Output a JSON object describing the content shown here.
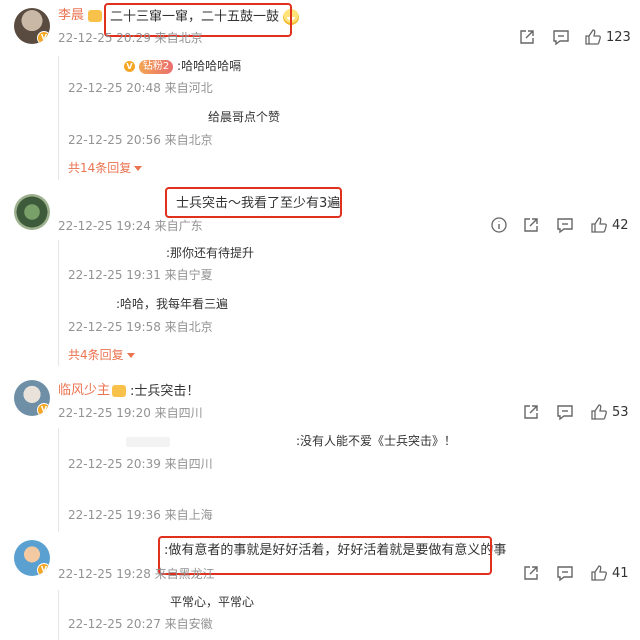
{
  "comments": [
    {
      "username": "李晨",
      "text": "二十三窜一窜，二十五鼓一鼓",
      "meta": "22-12-25 20:29 来自北京",
      "likes": "123",
      "replies": [
        {
          "text": ":哈哈哈哈嗝",
          "badge": "钻粉2",
          "meta": "22-12-25 20:48 来自河北"
        },
        {
          "text": "给晨哥点个赞",
          "meta": "22-12-25 20:56 来自北京"
        }
      ],
      "more": "共14条回复"
    },
    {
      "username": "",
      "text": "士兵突击～我看了至少有3遍",
      "meta": "22-12-25 19:24 来自广东",
      "likes": "42",
      "replies": [
        {
          "text": ":那你还有待提升",
          "meta": "22-12-25 19:31 来自宁夏"
        },
        {
          "text": ":哈哈，我每年看三遍",
          "meta": "22-12-25 19:58 来自北京"
        }
      ],
      "more": "共4条回复"
    },
    {
      "username": "临风少主",
      "text": ":士兵突击！",
      "meta": "22-12-25 19:20 来自四川",
      "likes": "53",
      "replies": [
        {
          "text": ":没有人能不爱《士兵突击》！",
          "meta": "22-12-25 20:39 来自四川"
        },
        {
          "text": "",
          "meta": "22-12-25 19:36 来自上海"
        }
      ]
    },
    {
      "username": "",
      "text": ":做有意者的事就是好好活着，好好活着就是要做有意义的事",
      "meta": "22-12-25 19:28 来自黑龙江",
      "likes": "41",
      "replies": [
        {
          "text": "平常心，平常心",
          "meta": "22-12-25 20:27 来自安徽"
        }
      ]
    }
  ],
  "colors": {
    "accent": "#eb7350",
    "highlight_box": "#e0301e",
    "meta": "#939393"
  }
}
